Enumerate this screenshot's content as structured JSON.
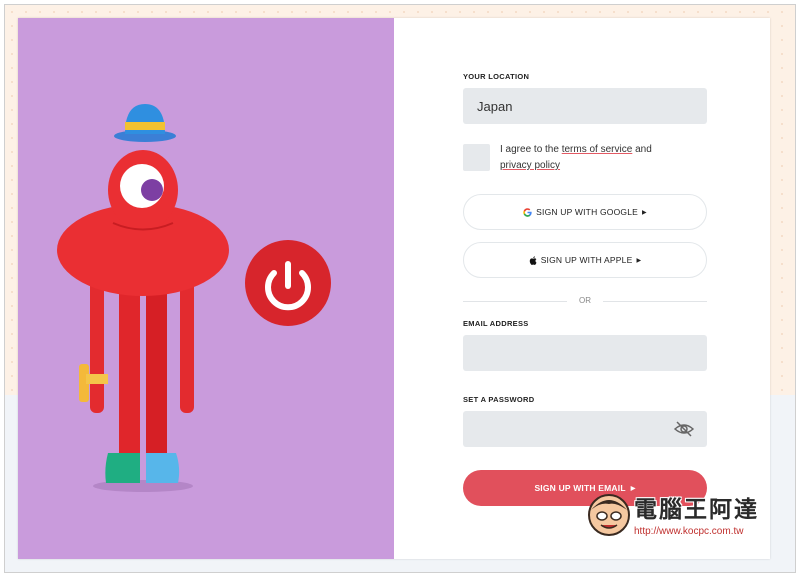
{
  "form": {
    "location_label": "YOUR LOCATION",
    "location_value": "Japan",
    "agree_prefix": "I agree to the ",
    "terms_link": "terms of service",
    "agree_middle": " and",
    "privacy_link": "privacy policy",
    "google_button": "SIGN UP WITH GOOGLE",
    "apple_button": "SIGN UP WITH APPLE",
    "or_divider": "OR",
    "email_label": "EMAIL ADDRESS",
    "email_value": "",
    "password_label": "SET A PASSWORD",
    "password_value": "",
    "email_signup_button": "SIGN UP WITH EMAIL"
  },
  "watermark": {
    "title": "電腦王阿達",
    "url": "http://www.kocpc.com.tw"
  },
  "colors": {
    "illustration_bg": "#c99bdc",
    "primary": "#e1505c",
    "field_bg": "#e6e9ec"
  }
}
